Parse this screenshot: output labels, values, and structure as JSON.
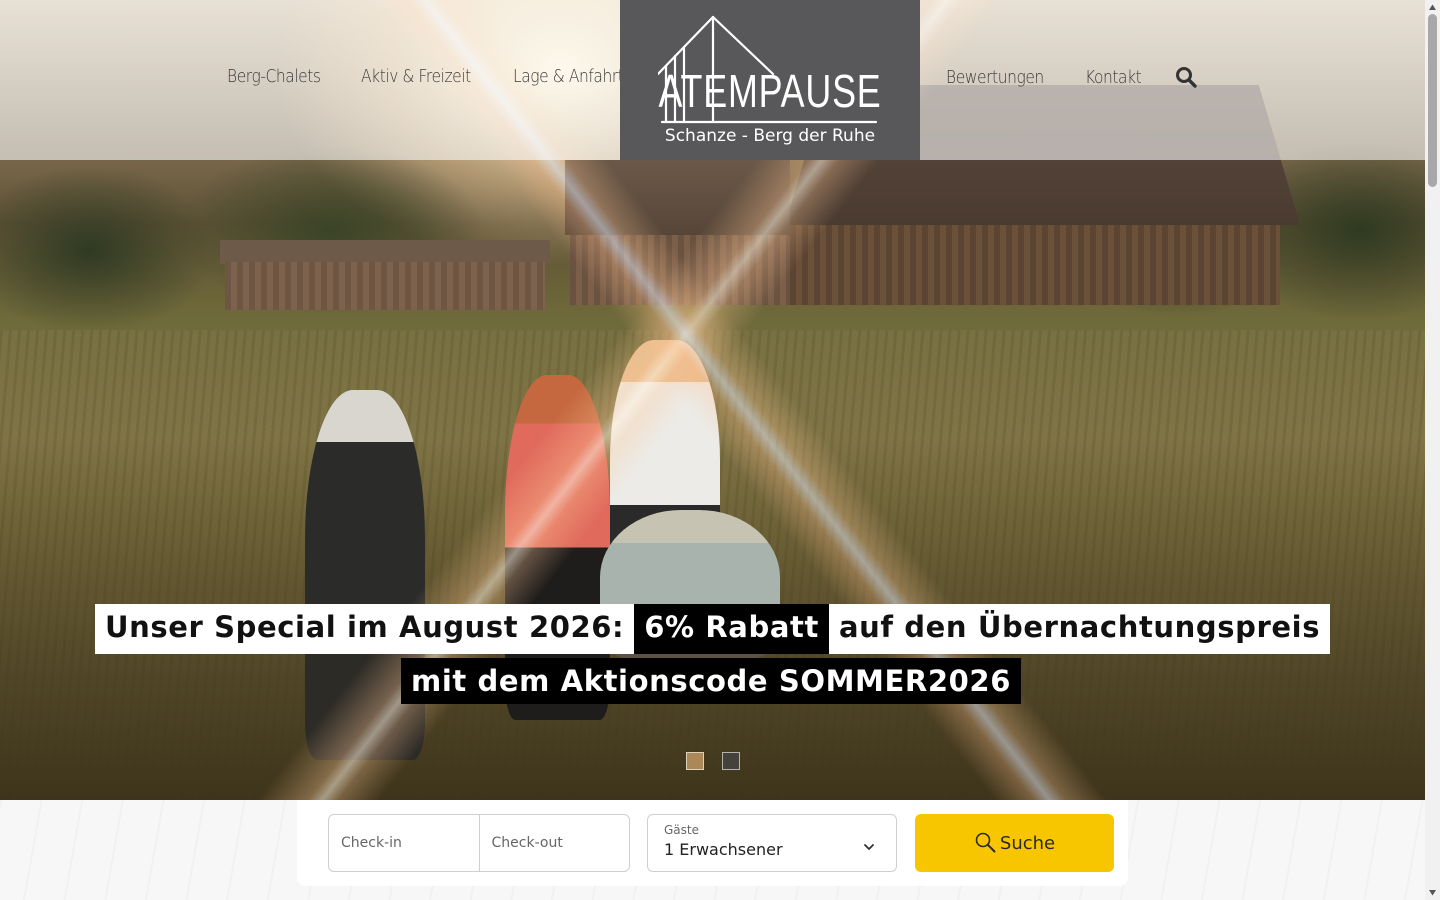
{
  "nav": {
    "left": [
      "Berg-Chalets",
      "Aktiv & Freizeit",
      "Lage & Anfahrt"
    ],
    "right": [
      "Bewertungen",
      "Kontakt"
    ],
    "search_icon": "search-icon"
  },
  "logo": {
    "wordmark": "ATEMPAUSE",
    "tagline": "Schanze - Berg der Ruhe",
    "background": "#58585a"
  },
  "promo": {
    "line1_part1": "Unser Special im August 2026:",
    "line1_highlight": "6% Rabatt",
    "line1_part2": "auf den Übernachtungspreis",
    "line2": "mit dem Aktionscode SOMMER2026"
  },
  "slider": {
    "slides": 2,
    "active_index": 0
  },
  "booking": {
    "checkin_placeholder": "Check-in",
    "checkout_placeholder": "Check-out",
    "guests_label": "Gäste",
    "guests_value": "1 Erwachsener",
    "search_label": "Suche",
    "accent": "#f7c600"
  }
}
